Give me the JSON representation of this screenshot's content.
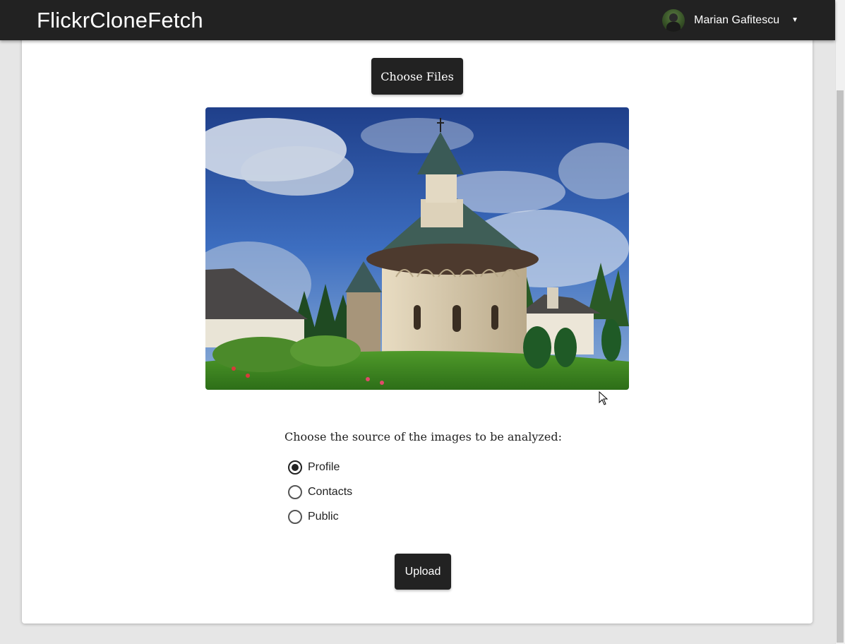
{
  "navbar": {
    "brand": "FlickrCloneFetch",
    "user_name": "Marian Gafitescu",
    "caret": "▼"
  },
  "upload_form": {
    "choose_files_label": "Choose Files",
    "preview_alt": "Selected photo preview",
    "source_prompt": "Choose the source of the images to be analyzed:",
    "sources": [
      {
        "label": "Profile",
        "checked": true
      },
      {
        "label": "Contacts",
        "checked": false
      },
      {
        "label": "Public",
        "checked": false
      }
    ],
    "upload_label": "Upload"
  },
  "colors": {
    "navbar_bg": "#222222",
    "page_bg": "#e6e6e6",
    "card_bg": "#ffffff",
    "button_bg": "#222222"
  }
}
